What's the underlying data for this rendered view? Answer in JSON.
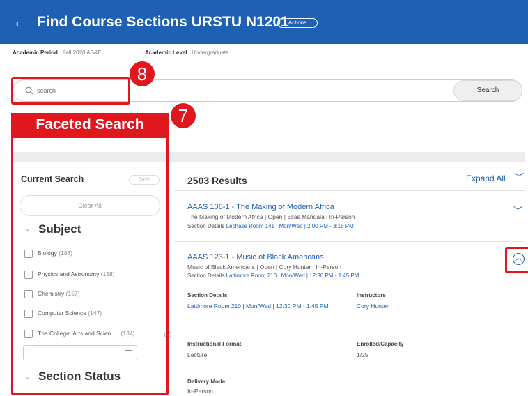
{
  "header": {
    "back_icon": "arrow-left-icon",
    "title": "Find Course Sections URSTU N1201",
    "actions_label": "Actions"
  },
  "meta": {
    "academic_period_label": "Academic Period",
    "academic_period_value": "Fall 2020 AS&E",
    "academic_level_label": "Academic Level",
    "academic_level_value": "Undergraduate"
  },
  "search": {
    "placeholder": "search",
    "button_label": "Search",
    "icon": "search-icon"
  },
  "callouts": {
    "search_number": "8",
    "facet_number": "7",
    "facet_label": "Faceted Search"
  },
  "sidebar": {
    "current_search_label": "Current Search",
    "save_label": "Save",
    "clear_all_label": "Clear All",
    "subject_heading": "Subject",
    "subject_items": [
      {
        "label": "Biology",
        "count": "(183)"
      },
      {
        "label": "Physics and Astronomy",
        "count": "(158)"
      },
      {
        "label": "Chemistry",
        "count": "(157)"
      },
      {
        "label": "Computer Science",
        "count": "(147)"
      },
      {
        "label": "The College: Arts and Scien...",
        "count": "(134)"
      }
    ],
    "section_status_heading": "Section Status"
  },
  "results": {
    "count_label": "2503 Results",
    "expand_all_label": "Expand All",
    "items": [
      {
        "title": "AAAS 106-1 - The Making of Modern Africa",
        "subtitle": "The Making of Modern Africa  |  Open  |  Elias Mandala  |  In-Person",
        "details_prefix": "Section Details",
        "details_link": "Lechase Room 141 | Mon/Wed | 2:00 PM - 3:15 PM"
      },
      {
        "title": "AAAS 123-1 - Music of Black Americans",
        "subtitle": "Music of Black Americans  |  Open  |  Cory Hunter  |  In-Person",
        "details_prefix": "Section Details",
        "details_link": "Lattimore Room 210 | Mon/Wed | 12:30 PM - 1:45 PM"
      }
    ],
    "expanded": {
      "section_details_label": "Section Details",
      "section_details_value": "Lattimore Room 210 | Mon/Wed | 12:30 PM - 1:45 PM",
      "instructors_label": "Instructors",
      "instructors_value": "Cory Hunter",
      "format_label": "Instructional Format",
      "format_value": "Lecture",
      "enrolled_label": "Enrolled/Capacity",
      "enrolled_value": "1/25",
      "delivery_label": "Delivery Mode",
      "delivery_value": "In-Person"
    }
  },
  "colors": {
    "header_blue": "#1e60b3",
    "callout_red": "#e0171d",
    "link_blue": "#1e60b3"
  }
}
